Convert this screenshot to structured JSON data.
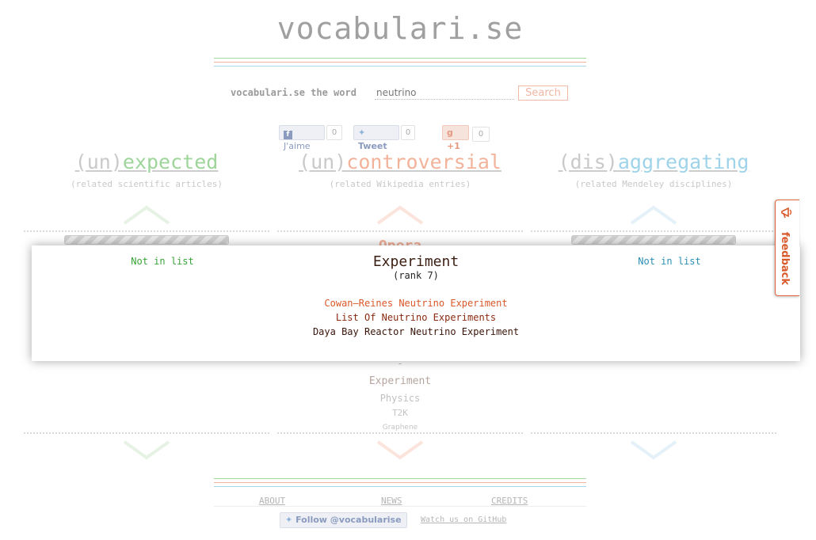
{
  "site": {
    "title": "vocabulari.se"
  },
  "search": {
    "label": "vocabulari.se the word",
    "value": "neutrino",
    "button_label": "Search"
  },
  "social": {
    "like_label": "J'aime",
    "like_count": "0",
    "tweet_label": "Tweet",
    "tweet_count": "0",
    "plusone_label": "+1",
    "plusone_count": "0"
  },
  "columns": [
    {
      "prefix": "(un)",
      "word": "expected",
      "subtitle": "(related scientific articles)",
      "color": "#9ed59a"
    },
    {
      "prefix": "(un)",
      "word": "controversial",
      "subtitle": "(related Wikipedia entries)",
      "color": "#f3b29a"
    },
    {
      "prefix": "(dis)",
      "word": "aggregating",
      "subtitle": "(related Mendeley disciplines)",
      "color": "#9fd3ea"
    }
  ],
  "middle_list": {
    "partial_top": "Opera",
    "dash": "-",
    "items": [
      "Experiment",
      "Physics",
      "T2K",
      "Graphene"
    ]
  },
  "overlay": {
    "left_status": "Not in list",
    "right_status": "Not in list",
    "title": "Experiment",
    "rank": "(rank 7)",
    "entries": [
      {
        "text": "Cowan–Reines Neutrino Experiment",
        "color": "#d9582a"
      },
      {
        "text": "List Of Neutrino Experiments",
        "color": "#8a2a10"
      },
      {
        "text": "Daya Bay Reactor Neutrino Experiment",
        "color": "#3a1408"
      }
    ]
  },
  "footer": {
    "links": [
      "ABOUT",
      "NEWS",
      "CREDITS"
    ],
    "follow_label": "Follow @vocabularise",
    "github_label": "Watch us on GitHub"
  },
  "feedback": {
    "label": "feedback"
  },
  "colors": {
    "green": "#a6d9a0",
    "orange": "#f3b29a",
    "blue": "#a8d6ea",
    "feedback": "#e0663a"
  }
}
